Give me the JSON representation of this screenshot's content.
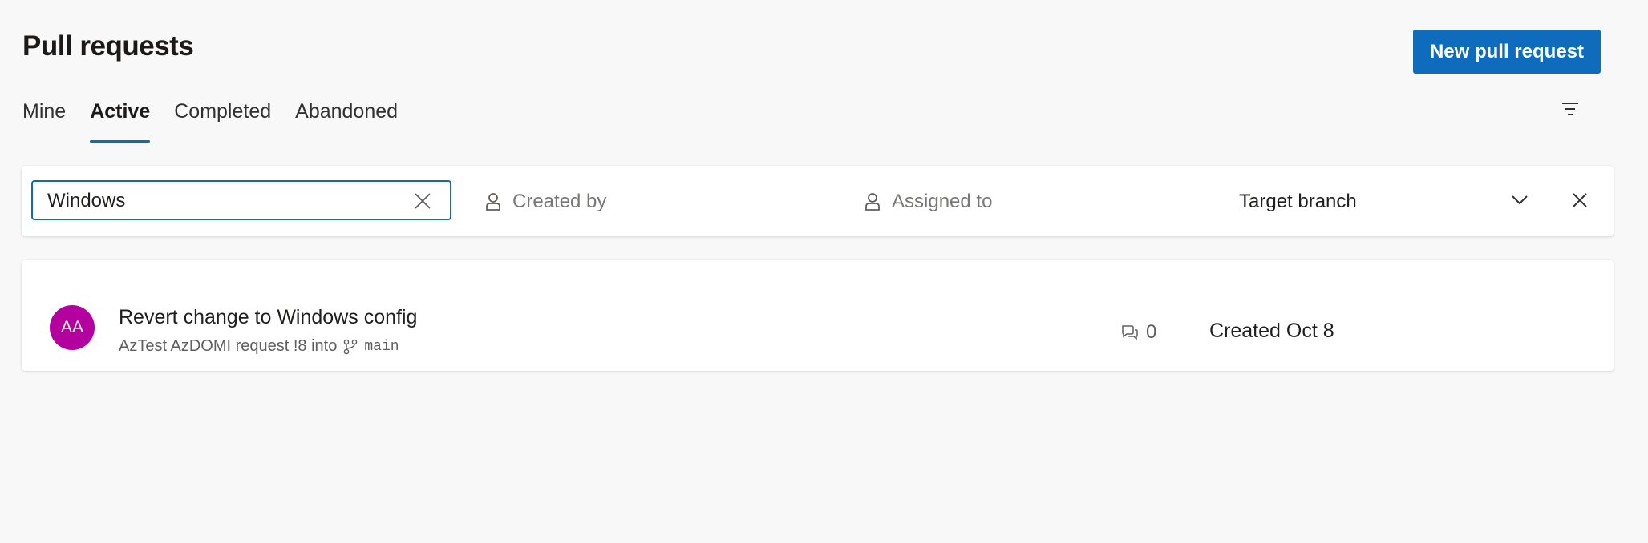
{
  "header": {
    "title": "Pull requests",
    "new_button": "New pull request"
  },
  "tabs": [
    {
      "label": "Mine",
      "active": false
    },
    {
      "label": "Active",
      "active": true
    },
    {
      "label": "Completed",
      "active": false
    },
    {
      "label": "Abandoned",
      "active": false
    }
  ],
  "filters": {
    "search_value": "Windows",
    "created_by": "Created by",
    "assigned_to": "Assigned to",
    "target_branch": "Target branch"
  },
  "pull_requests": [
    {
      "avatar_initials": "AA",
      "avatar_color": "#b4009e",
      "title": "Revert change to Windows config",
      "subtitle": "AzTest AzDOMI request !8 into",
      "target_branch": "main",
      "comment_count": "0",
      "created": "Created Oct 8"
    }
  ],
  "colors": {
    "accent": "#0f6cbd",
    "background": "#f8f8f8"
  }
}
